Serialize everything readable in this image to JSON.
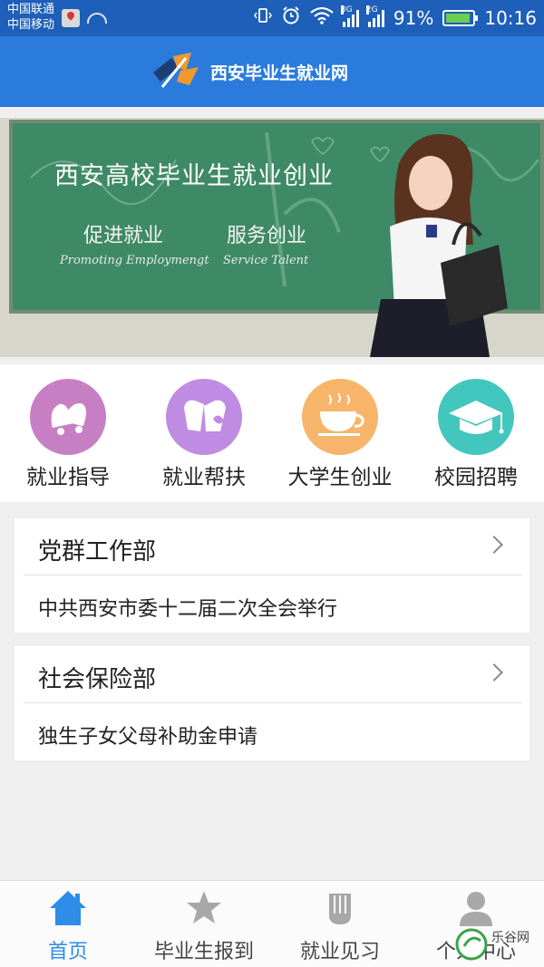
{
  "status_bar": {
    "carrier_1": "中国联通",
    "carrier_2": "中国移动",
    "net_1": "3G",
    "net_2": "2G",
    "battery_percent": "91%",
    "time": "10:16",
    "icons": [
      "map-pin-icon",
      "android-icon",
      "vibrate-icon",
      "alarm-icon",
      "wifi-icon",
      "signal-icon",
      "battery-icon"
    ]
  },
  "header": {
    "title": "西安毕业生就业网",
    "brand_colors": {
      "bar": "#2a7bdc",
      "status": "#1d5fb9"
    }
  },
  "banner": {
    "title": "西安高校毕业生就业创业",
    "sub_left": "促进就业",
    "sub_right": "服务创业",
    "en_left": "Promoting Employmengt",
    "en_right": "Service Talent"
  },
  "quick_menu": [
    {
      "label": "就业指导",
      "icon": "bells-icon",
      "color": "#c77fc4"
    },
    {
      "label": "就业帮扶",
      "icon": "mittens-icon",
      "color": "#c08be3"
    },
    {
      "label": "大学生创业",
      "icon": "cup-icon",
      "color": "#f6b56a"
    },
    {
      "label": "校园招聘",
      "icon": "graduation-cap-icon",
      "color": "#43c6bd"
    }
  ],
  "sections": [
    {
      "title": "党群工作部",
      "item": "中共西安市委十二届二次全会举行"
    },
    {
      "title": "社会保险部",
      "item": "独生子女父母补助金申请"
    }
  ],
  "bottom_nav": [
    {
      "label": "首页",
      "icon": "home-icon",
      "active": true
    },
    {
      "label": "毕业生报到",
      "icon": "star-icon",
      "active": false
    },
    {
      "label": "就业见习",
      "icon": "glove-icon",
      "active": false
    },
    {
      "label": "个人中心",
      "icon": "person-icon",
      "active": false
    }
  ],
  "watermark": "乐谷网"
}
